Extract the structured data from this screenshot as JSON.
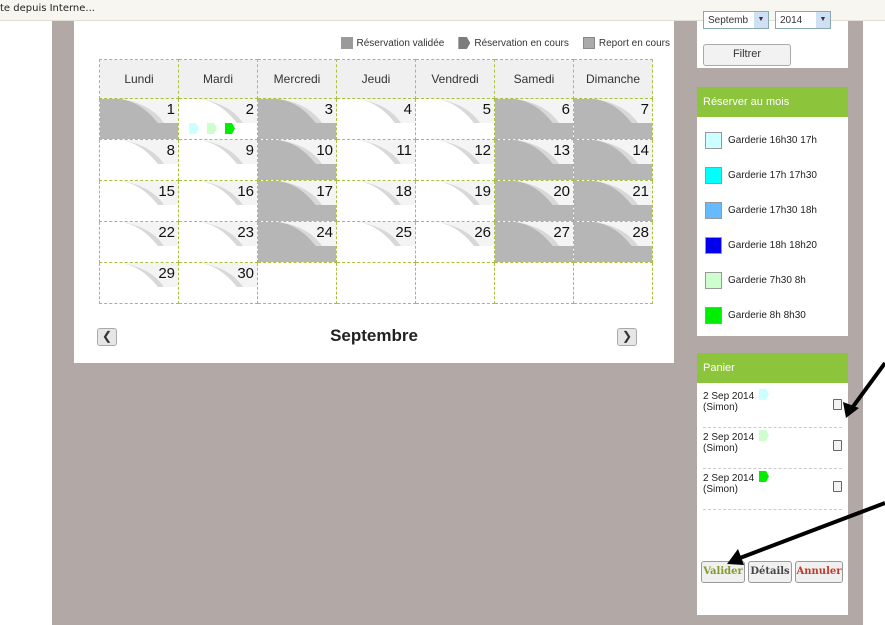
{
  "top_bar": {
    "text": "te depuis Interne..."
  },
  "legend": [
    {
      "label": "Réservation validée",
      "icon": "validated-square-icon"
    },
    {
      "label": "Réservation en cours",
      "icon": "pending-reservation-icon"
    },
    {
      "label": "Report en cours",
      "icon": "report-icon"
    }
  ],
  "calendar": {
    "month": "Septembre",
    "days_header": [
      "Lundi",
      "Mardi",
      "Mercredi",
      "Jeudi",
      "Vendredi",
      "Samedi",
      "Dimanche"
    ],
    "weeks": [
      [
        {
          "d": "1",
          "gray": true
        },
        {
          "d": "2",
          "gray": false,
          "icons": [
            "#ccffff",
            "#ccffcc",
            "#00ee00"
          ]
        },
        {
          "d": "3",
          "gray": true
        },
        {
          "d": "4",
          "gray": false
        },
        {
          "d": "5",
          "gray": false
        },
        {
          "d": "6",
          "gray": true
        },
        {
          "d": "7",
          "gray": true
        }
      ],
      [
        {
          "d": "8",
          "gray": false
        },
        {
          "d": "9",
          "gray": false
        },
        {
          "d": "10",
          "gray": true
        },
        {
          "d": "11",
          "gray": false
        },
        {
          "d": "12",
          "gray": false
        },
        {
          "d": "13",
          "gray": true
        },
        {
          "d": "14",
          "gray": true
        }
      ],
      [
        {
          "d": "15",
          "gray": false
        },
        {
          "d": "16",
          "gray": false
        },
        {
          "d": "17",
          "gray": true
        },
        {
          "d": "18",
          "gray": false
        },
        {
          "d": "19",
          "gray": false
        },
        {
          "d": "20",
          "gray": true
        },
        {
          "d": "21",
          "gray": true
        }
      ],
      [
        {
          "d": "22",
          "gray": false
        },
        {
          "d": "23",
          "gray": false
        },
        {
          "d": "24",
          "gray": true
        },
        {
          "d": "25",
          "gray": false
        },
        {
          "d": "26",
          "gray": false
        },
        {
          "d": "27",
          "gray": true
        },
        {
          "d": "28",
          "gray": true
        }
      ],
      [
        {
          "d": "29",
          "gray": false
        },
        {
          "d": "30",
          "gray": false
        },
        null,
        null,
        null,
        null,
        null
      ]
    ]
  },
  "filter": {
    "month_value": "Septemb",
    "year_value": "2014",
    "button": "Filtrer"
  },
  "reserve_month": {
    "title": "Réserver au mois",
    "items": [
      {
        "label": "Garderie 16h30 17h",
        "color": "#ccffff"
      },
      {
        "label": "Garderie 17h 17h30",
        "color": "#00ffff"
      },
      {
        "label": "Garderie 17h30 18h",
        "color": "#66bbff"
      },
      {
        "label": "Garderie 18h 18h20",
        "color": "#0000ee"
      },
      {
        "label": "Garderie 7h30 8h",
        "color": "#ccffcc"
      },
      {
        "label": "Garderie 8h 8h30",
        "color": "#00ee00"
      }
    ]
  },
  "cart": {
    "title": "Panier",
    "items": [
      {
        "date": "2 Sep 2014",
        "name": "(Simon)",
        "icon_color": "#ccffff"
      },
      {
        "date": "2 Sep 2014",
        "name": "(Simon)",
        "icon_color": "#ccffcc"
      },
      {
        "date": "2 Sep 2014",
        "name": "(Simon)",
        "icon_color": "#00ee00"
      }
    ],
    "buttons": {
      "valider": "Valider",
      "details": "Détails",
      "annuler": "Annuler"
    }
  }
}
